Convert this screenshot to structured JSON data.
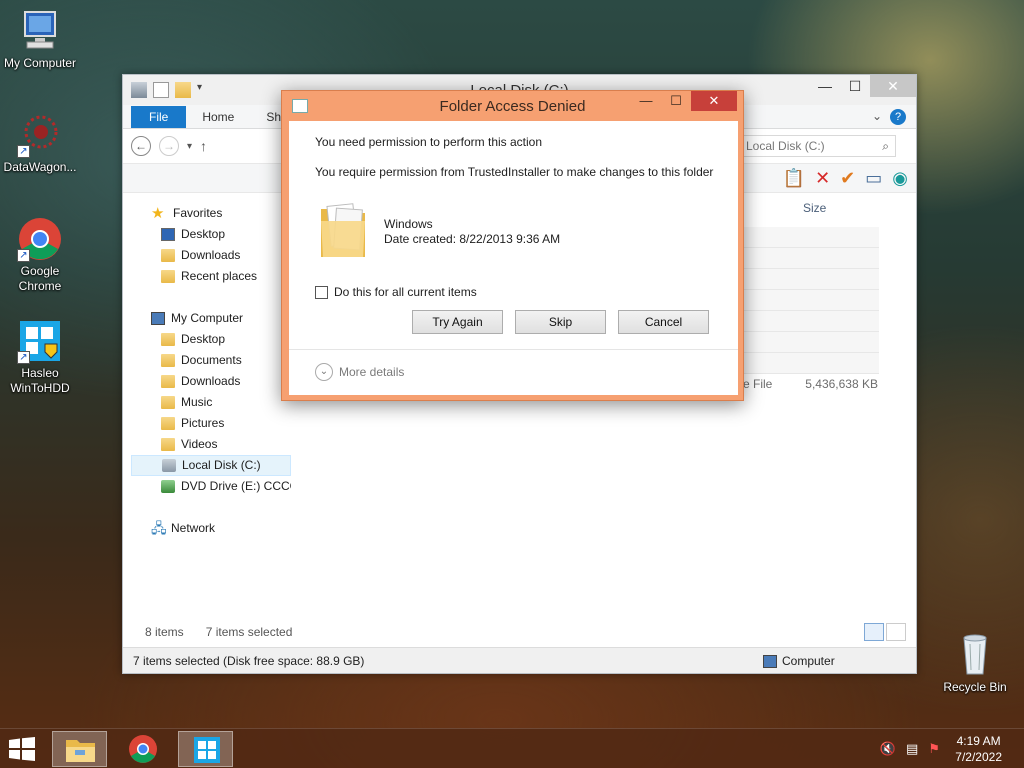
{
  "desktop": {
    "icons": [
      {
        "label": "My Computer"
      },
      {
        "label": "DataWagon..."
      },
      {
        "label": "Google Chrome"
      },
      {
        "label": "Hasleo WinToHDD"
      },
      {
        "label": "Recycle Bin"
      }
    ]
  },
  "explorer": {
    "title": "Local Disk (C:)",
    "tabs": [
      "File",
      "Home",
      "Shar"
    ],
    "search_placeholder": "Local Disk (C:)",
    "column_size": "Size",
    "nav": {
      "favorites": "Favorites",
      "fav_items": [
        "Desktop",
        "Downloads",
        "Recent places"
      ],
      "computer": "My Computer",
      "comp_items": [
        "Desktop",
        "Documents",
        "Downloads",
        "Music",
        "Pictures",
        "Videos",
        "Local Disk (C:)",
        "DVD Drive (E:) CCCC"
      ],
      "network": "Network"
    },
    "file_row": {
      "type": "e File",
      "size": "5,436,638 KB"
    },
    "status": {
      "items": "8 items",
      "selected": "7 items selected",
      "bottom": "7 items selected (Disk free space: 88.9 GB)",
      "location": "Computer"
    }
  },
  "dialog": {
    "title": "Folder Access Denied",
    "message": "You need permission to perform this action",
    "detail": "You require permission from TrustedInstaller to make changes to this folder",
    "folder_name": "Windows",
    "date_created": "Date created: 8/22/2013 9:36 AM",
    "checkbox_label": "Do this for all current items",
    "buttons": {
      "try_again": "Try Again",
      "skip": "Skip",
      "cancel": "Cancel"
    },
    "more_details": "More details"
  },
  "taskbar": {
    "time": "4:19 AM",
    "date": "7/2/2022"
  }
}
